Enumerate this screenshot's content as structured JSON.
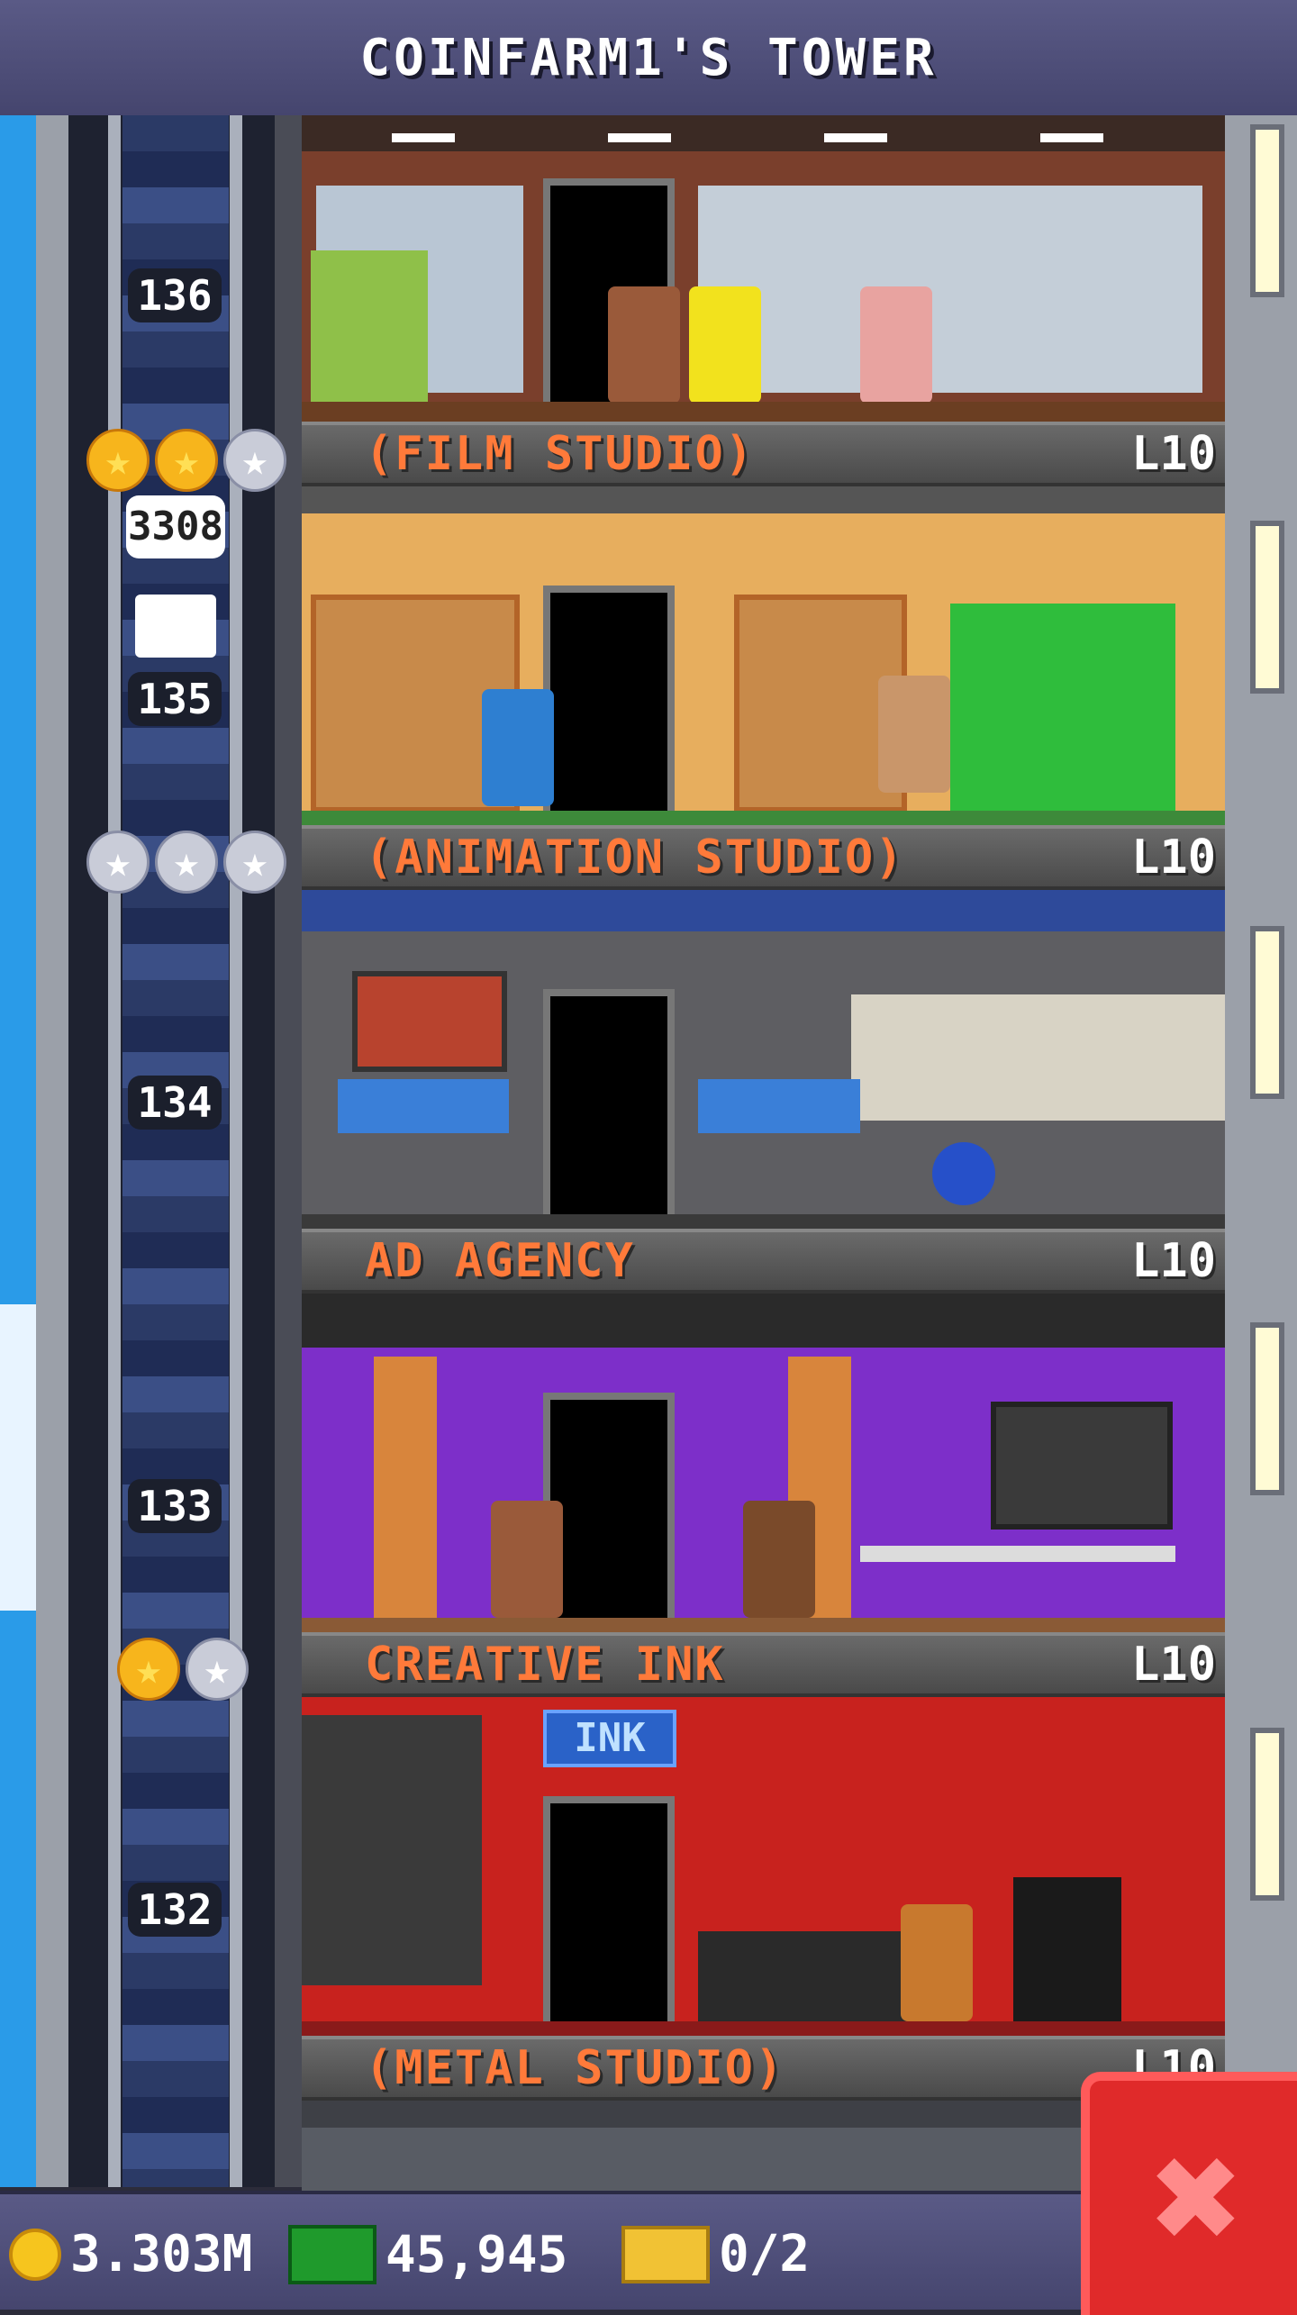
{
  "header": {
    "title": "COINFARM1'S TOWER"
  },
  "elevator": {
    "floor_numbers": [
      "136",
      "135",
      "134",
      "133",
      "132"
    ],
    "bubble_text": "3308"
  },
  "floors": [
    {
      "name": "(FILM STUDIO)",
      "level": "L10"
    },
    {
      "name": "(ANIMATION STUDIO)",
      "level": "L10"
    },
    {
      "name": "AD AGENCY",
      "level": "L10"
    },
    {
      "name": "CREATIVE INK",
      "level": "L10"
    },
    {
      "name": "(METAL STUDIO)",
      "level": "L10"
    }
  ],
  "creative_ink_sign": "INK",
  "bottom": {
    "coins": "3.303M",
    "bux": "45,945",
    "tickets": "0/2"
  },
  "colors": {
    "label_text": "#ff7a3a",
    "close_button": "#e02a2a"
  }
}
